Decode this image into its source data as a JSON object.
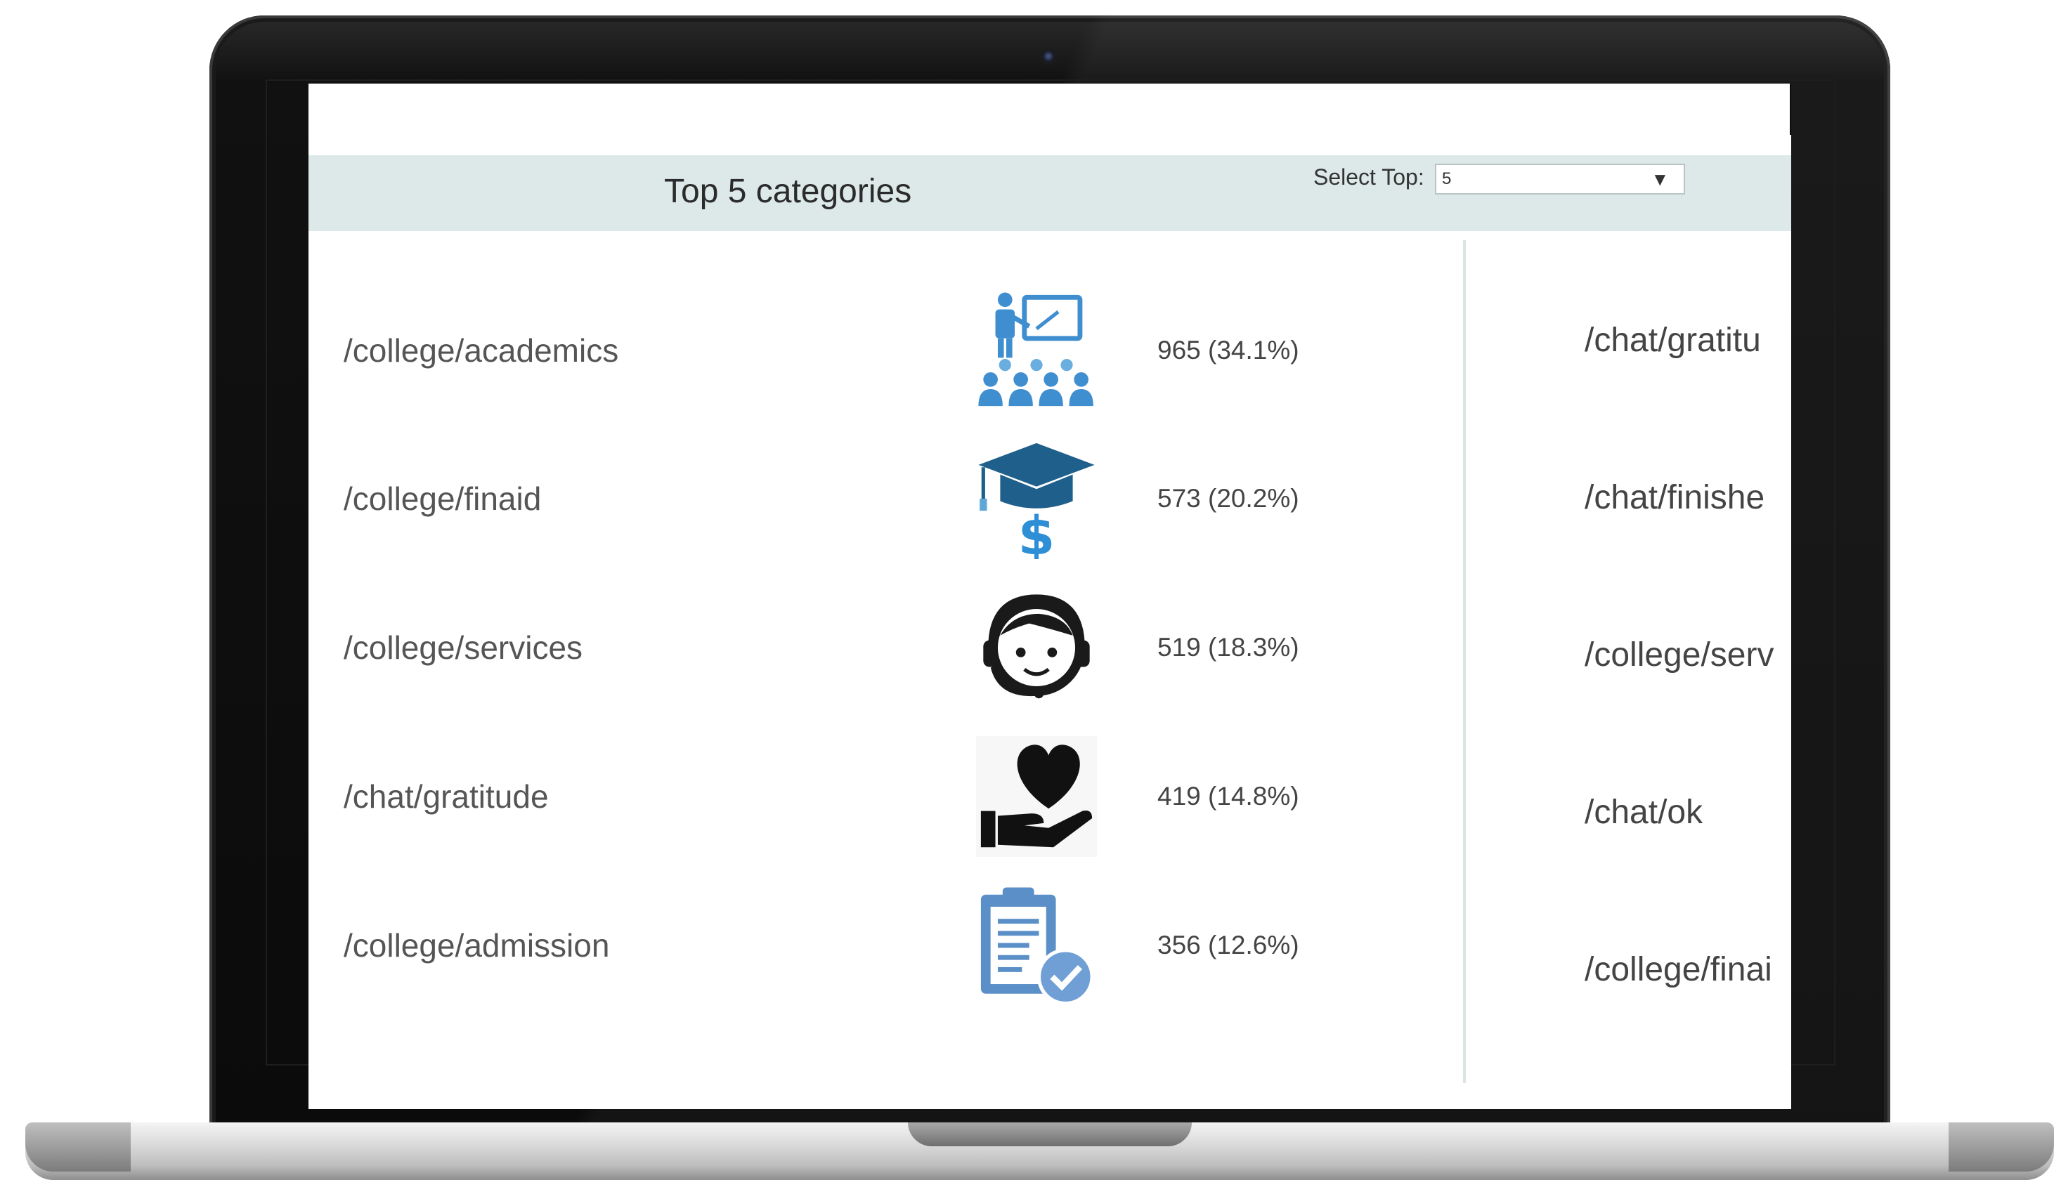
{
  "header": {
    "title": "Top 5 categories",
    "select_label": "Select Top:",
    "select_value": "5"
  },
  "categories": [
    {
      "label": "/college/academics",
      "value": "965  (34.1%)",
      "icon": "teacher-classroom-icon",
      "icon_color": "#3f8fd0"
    },
    {
      "label": "/college/finaid",
      "value": "573  (20.2%)",
      "icon": "graduation-cap-dollar-icon",
      "icon_color": "#1f5f8b"
    },
    {
      "label": "/college/services",
      "value": "519  (18.3%)",
      "icon": "support-headset-icon",
      "icon_color": "#1a1a1a"
    },
    {
      "label": "/chat/gratitude",
      "value": "419  (14.8%)",
      "icon": "heart-in-hand-icon",
      "icon_color": "#111111"
    },
    {
      "label": "/college/admission",
      "value": "356  (12.6%)",
      "icon": "clipboard-check-icon",
      "icon_color": "#5b8fc7"
    }
  ],
  "right_panel": {
    "items": [
      "/chat/gratitu",
      "/chat/finishe",
      "/college/serv",
      "/chat/ok",
      "/college/finai"
    ]
  }
}
